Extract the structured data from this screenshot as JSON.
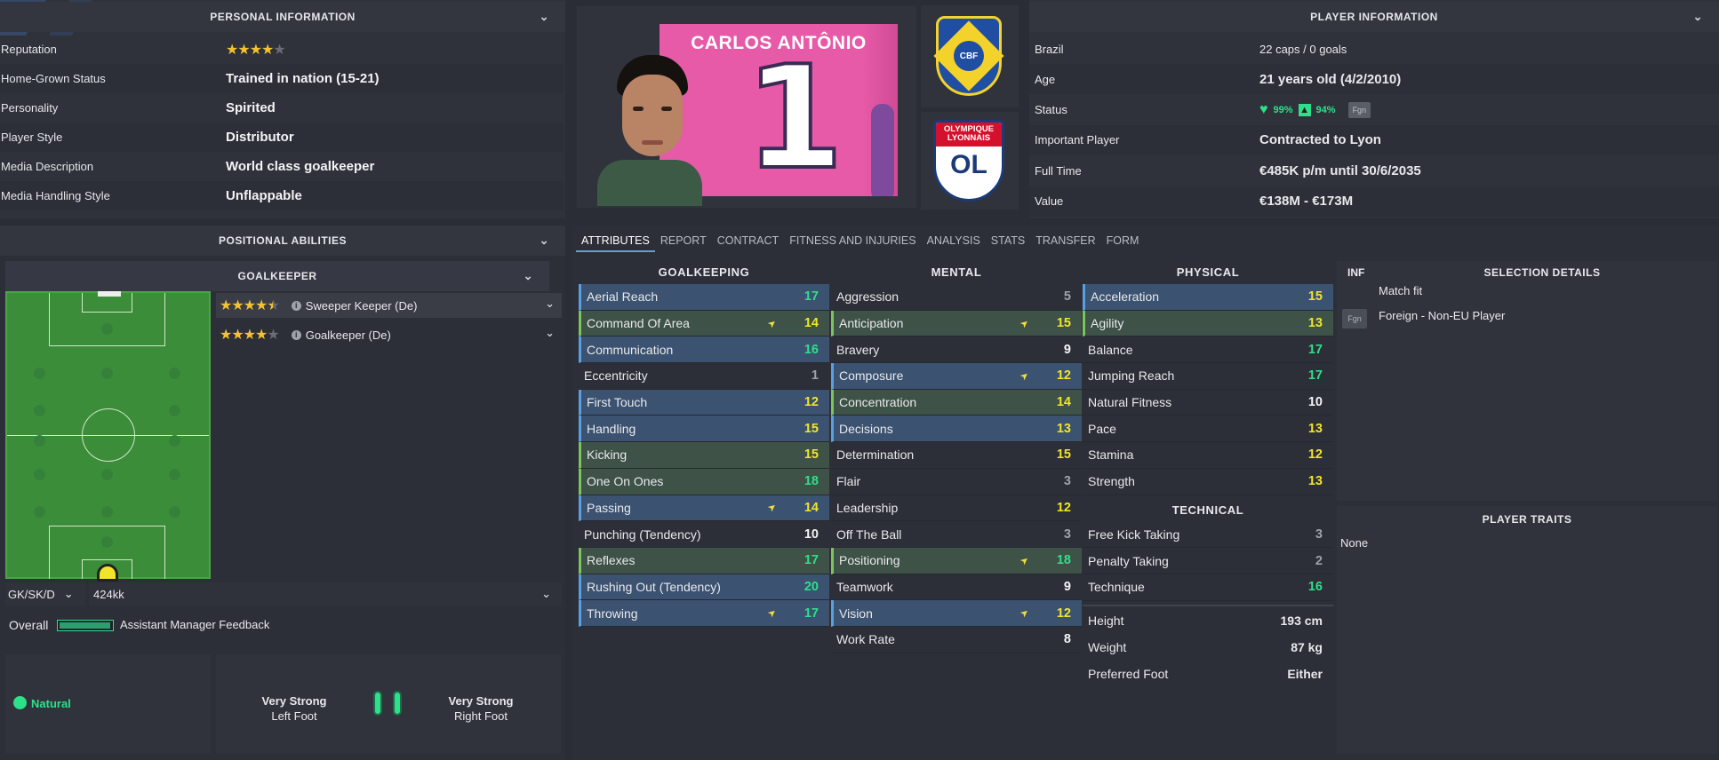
{
  "personal": {
    "title": "PERSONAL INFORMATION",
    "rows": [
      {
        "label": "Reputation",
        "stars": 4,
        "max": 5
      },
      {
        "label": "Home-Grown Status",
        "value": "Trained in nation (15-21)"
      },
      {
        "label": "Personality",
        "value": "Spirited"
      },
      {
        "label": "Player Style",
        "value": "Distributor"
      },
      {
        "label": "Media Description",
        "value": "World class goalkeeper"
      },
      {
        "label": "Media Handling Style",
        "value": "Unflappable"
      }
    ]
  },
  "player_card": {
    "name": "CARLOS ANTÔNIO",
    "number": "1",
    "nation_badge": "CBF",
    "club_badge_top": "OLYMPIQUE LYONNAIS",
    "club_badge_bottom": "OL"
  },
  "player_info": {
    "title": "PLAYER INFORMATION",
    "rows": [
      {
        "label": "Brazil",
        "value": "22 caps / 0 goals"
      },
      {
        "label": "Age",
        "value": "21 years old (4/2/2010)"
      },
      {
        "label": "Status",
        "condition": "99%",
        "sharpness": "94%",
        "badge": "Fgn"
      },
      {
        "label": "Important Player",
        "value": "Contracted to Lyon"
      },
      {
        "label": "Full Time",
        "value": "€485K p/m until 30/6/2035"
      },
      {
        "label": "Value",
        "value": "€138M - €173M"
      }
    ]
  },
  "positional": {
    "title": "POSITIONAL ABILITIES",
    "sub": "GOALKEEPER",
    "roles": [
      {
        "name": "Sweeper Keeper (De)",
        "stars": 4.5
      },
      {
        "name": "Goalkeeper (De)",
        "stars": 4
      }
    ],
    "position_select": "GK/SK/D",
    "formation_select": "424kk",
    "overall": "Overall",
    "feedback": "Assistant Manager Feedback"
  },
  "feet": {
    "natural": "Natural",
    "left_label": "Very Strong",
    "left_sub": "Left Foot",
    "right_label": "Very Strong",
    "right_sub": "Right Foot"
  },
  "tabs": [
    "ATTRIBUTES",
    "REPORT",
    "CONTRACT",
    "FITNESS AND INJURIES",
    "ANALYSIS",
    "STATS",
    "TRANSFER",
    "FORM"
  ],
  "goalkeeping": {
    "title": "GOALKEEPING",
    "items": [
      {
        "n": "Aerial Reach",
        "v": "17",
        "h": "b"
      },
      {
        "n": "Command Of Area",
        "v": "14",
        "h": "g",
        "up": true
      },
      {
        "n": "Communication",
        "v": "16",
        "h": "b"
      },
      {
        "n": "Eccentricity",
        "v": "1",
        "h": ""
      },
      {
        "n": "First Touch",
        "v": "12",
        "h": "b"
      },
      {
        "n": "Handling",
        "v": "15",
        "h": "b"
      },
      {
        "n": "Kicking",
        "v": "15",
        "h": "g"
      },
      {
        "n": "One On Ones",
        "v": "18",
        "h": "g"
      },
      {
        "n": "Passing",
        "v": "14",
        "h": "b",
        "up": true
      },
      {
        "n": "Punching (Tendency)",
        "v": "10",
        "h": ""
      },
      {
        "n": "Reflexes",
        "v": "17",
        "h": "g"
      },
      {
        "n": "Rushing Out (Tendency)",
        "v": "20",
        "h": "b"
      },
      {
        "n": "Throwing",
        "v": "17",
        "h": "b",
        "up": true
      }
    ]
  },
  "mental": {
    "title": "MENTAL",
    "items": [
      {
        "n": "Aggression",
        "v": "5",
        "h": ""
      },
      {
        "n": "Anticipation",
        "v": "15",
        "h": "g",
        "up": true
      },
      {
        "n": "Bravery",
        "v": "9",
        "h": ""
      },
      {
        "n": "Composure",
        "v": "12",
        "h": "b",
        "up": true
      },
      {
        "n": "Concentration",
        "v": "14",
        "h": "g"
      },
      {
        "n": "Decisions",
        "v": "13",
        "h": "b"
      },
      {
        "n": "Determination",
        "v": "15",
        "h": ""
      },
      {
        "n": "Flair",
        "v": "3",
        "h": ""
      },
      {
        "n": "Leadership",
        "v": "12",
        "h": ""
      },
      {
        "n": "Off The Ball",
        "v": "3",
        "h": ""
      },
      {
        "n": "Positioning",
        "v": "18",
        "h": "g",
        "up": true
      },
      {
        "n": "Teamwork",
        "v": "9",
        "h": ""
      },
      {
        "n": "Vision",
        "v": "12",
        "h": "b",
        "up": true
      },
      {
        "n": "Work Rate",
        "v": "8",
        "h": ""
      }
    ]
  },
  "physical": {
    "title": "PHYSICAL",
    "items": [
      {
        "n": "Acceleration",
        "v": "15",
        "h": "b"
      },
      {
        "n": "Agility",
        "v": "13",
        "h": "g"
      },
      {
        "n": "Balance",
        "v": "17",
        "h": ""
      },
      {
        "n": "Jumping Reach",
        "v": "17",
        "h": ""
      },
      {
        "n": "Natural Fitness",
        "v": "10",
        "h": ""
      },
      {
        "n": "Pace",
        "v": "13",
        "h": ""
      },
      {
        "n": "Stamina",
        "v": "12",
        "h": ""
      },
      {
        "n": "Strength",
        "v": "13",
        "h": ""
      }
    ]
  },
  "technical": {
    "title": "TECHNICAL",
    "items": [
      {
        "n": "Free Kick Taking",
        "v": "3",
        "h": ""
      },
      {
        "n": "Penalty Taking",
        "v": "2",
        "h": ""
      },
      {
        "n": "Technique",
        "v": "16",
        "h": ""
      }
    ]
  },
  "body": [
    {
      "n": "Height",
      "v": "193 cm"
    },
    {
      "n": "Weight",
      "v": "87 kg"
    },
    {
      "n": "Preferred Foot",
      "v": "Either"
    }
  ],
  "selection": {
    "inf": "INF",
    "title": "SELECTION DETAILS",
    "items": [
      {
        "badge": "",
        "text": "Match fit"
      },
      {
        "badge": "Fgn",
        "text": "Foreign - Non-EU Player"
      }
    ]
  },
  "traits": {
    "title": "PLAYER TRAITS",
    "value": "None"
  }
}
